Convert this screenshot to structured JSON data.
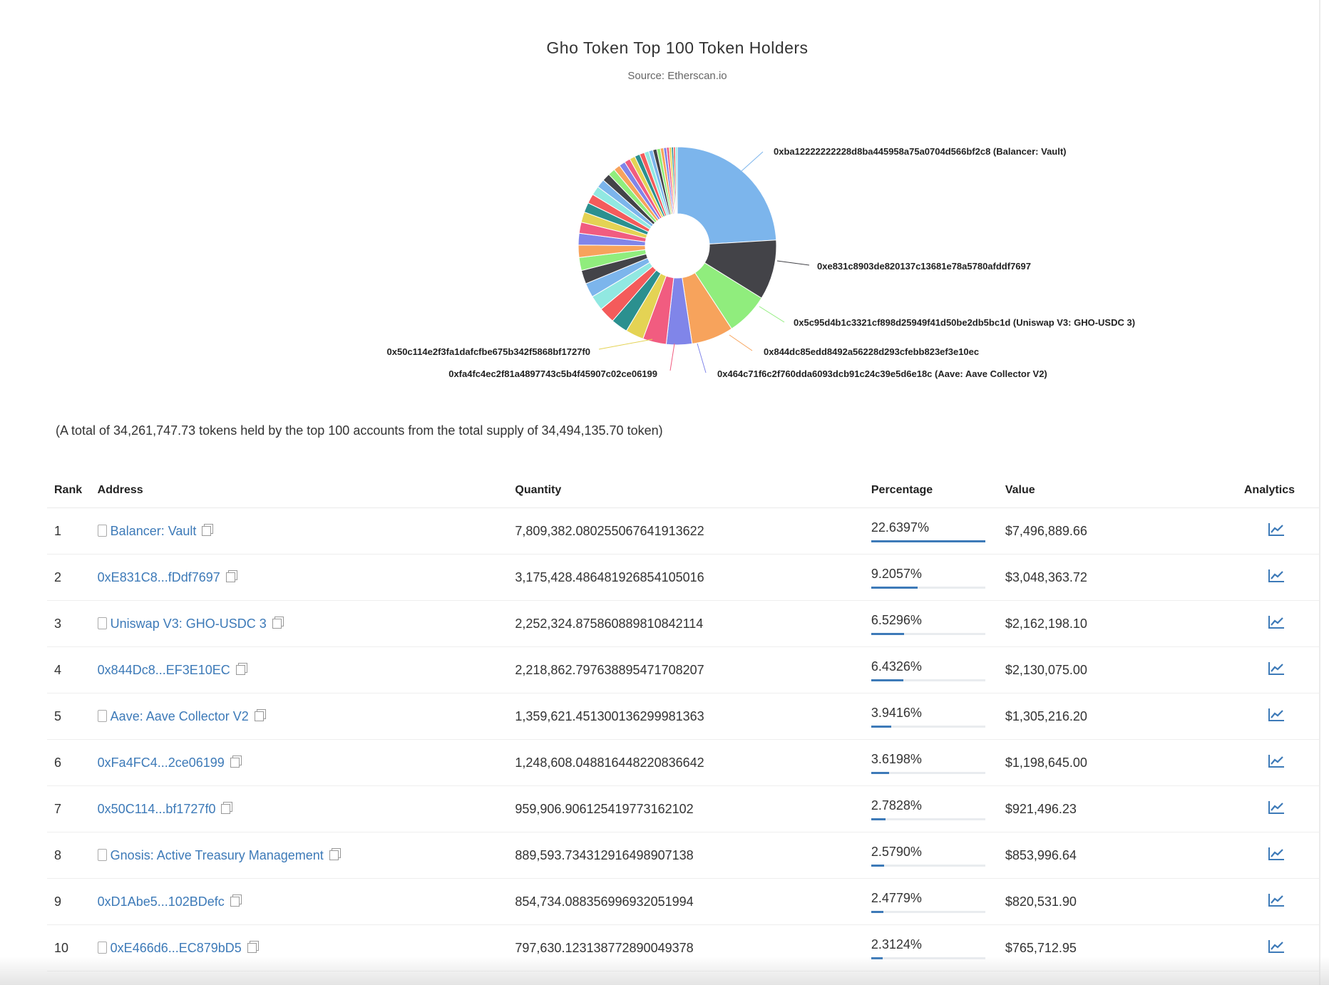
{
  "chart_data": {
    "type": "pie",
    "title": "Gho Token Top 100 Token Holders",
    "subtitle": "Source: Etherscan.io",
    "values": [
      22.6397,
      9.2057,
      6.5296,
      6.4326,
      3.9416,
      3.6198,
      2.7828,
      2.579,
      2.4779,
      2.3124,
      2.2,
      2.1,
      2.0,
      1.9,
      1.8,
      1.7,
      1.6,
      1.5,
      1.45,
      1.4,
      1.3,
      1.2,
      1.1,
      1.0,
      0.95,
      0.9,
      0.85,
      0.8,
      0.75,
      0.7,
      0.65,
      0.6,
      0.55,
      0.5,
      0.45,
      0.4,
      0.35,
      0.3,
      0.3,
      0.3
    ],
    "colors": [
      "#7cb5ec",
      "#434348",
      "#90ed7d",
      "#f7a35c",
      "#8085e9",
      "#f15c80",
      "#e4d354",
      "#2b908f",
      "#f45b5b",
      "#91e8e1"
    ],
    "labels": [
      "0xba12222222228d8ba445958a75a0704d566bf2c8 (Balancer: Vault)",
      "0xe831c8903de820137c13681e78a5780afddf7697",
      "0x5c95d4b1c3321cf898d25949f41d50be2db5bc1d (Uniswap V3: GHO-USDC 3)",
      "0x844dc85edd8492a56228d293cfebb823ef3e10ec",
      "0x464c71f6c2f760dda6093dcb91c24c39e5d6e18c (Aave: Aave Collector V2)",
      "0xfa4fc4ec2f81a4897743c5b4f45907c02ce06199",
      "0x50c114e2f3fa1dafcfbe675b342f5868bf1727f0"
    ]
  },
  "summary": "(A total of 34,261,747.73 tokens held by the top 100 accounts from the total supply of 34,494,135.70 token)",
  "table": {
    "headers": [
      "Rank",
      "Address",
      "Quantity",
      "Percentage",
      "Value",
      "Analytics"
    ],
    "rows": [
      {
        "rank": "1",
        "address": "Balancer: Vault",
        "contract": true,
        "quantity": "7,809,382.080255067641913622",
        "pct": "22.6397%",
        "pv": 22.6397,
        "value": "$7,496,889.66"
      },
      {
        "rank": "2",
        "address": "0xE831C8...fDdf7697",
        "contract": false,
        "quantity": "3,175,428.486481926854105016",
        "pct": "9.2057%",
        "pv": 9.2057,
        "value": "$3,048,363.72"
      },
      {
        "rank": "3",
        "address": "Uniswap V3: GHO-USDC 3",
        "contract": true,
        "quantity": "2,252,324.875860889810842114",
        "pct": "6.5296%",
        "pv": 6.5296,
        "value": "$2,162,198.10"
      },
      {
        "rank": "4",
        "address": "0x844Dc8...EF3E10EC",
        "contract": false,
        "quantity": "2,218,862.797638895471708207",
        "pct": "6.4326%",
        "pv": 6.4326,
        "value": "$2,130,075.00"
      },
      {
        "rank": "5",
        "address": "Aave: Aave Collector V2",
        "contract": true,
        "quantity": "1,359,621.451300136299981363",
        "pct": "3.9416%",
        "pv": 3.9416,
        "value": "$1,305,216.20"
      },
      {
        "rank": "6",
        "address": "0xFa4FC4...2ce06199",
        "contract": false,
        "quantity": "1,248,608.048816448220836642",
        "pct": "3.6198%",
        "pv": 3.6198,
        "value": "$1,198,645.00"
      },
      {
        "rank": "7",
        "address": "0x50C114...bf1727f0",
        "contract": false,
        "quantity": "959,906.906125419773162102",
        "pct": "2.7828%",
        "pv": 2.7828,
        "value": "$921,496.23"
      },
      {
        "rank": "8",
        "address": "Gnosis: Active Treasury Management",
        "contract": true,
        "quantity": "889,593.734312916498907138",
        "pct": "2.5790%",
        "pv": 2.579,
        "value": "$853,996.64"
      },
      {
        "rank": "9",
        "address": "0xD1Abe5...102BDefc",
        "contract": false,
        "quantity": "854,734.088356996932051994",
        "pct": "2.4779%",
        "pv": 2.4779,
        "value": "$820,531.90"
      },
      {
        "rank": "10",
        "address": "0xE466d6...EC879bD5",
        "contract": true,
        "quantity": "797,630.123138772890049378",
        "pct": "2.3124%",
        "pv": 2.3124,
        "value": "$765,712.95"
      }
    ]
  }
}
